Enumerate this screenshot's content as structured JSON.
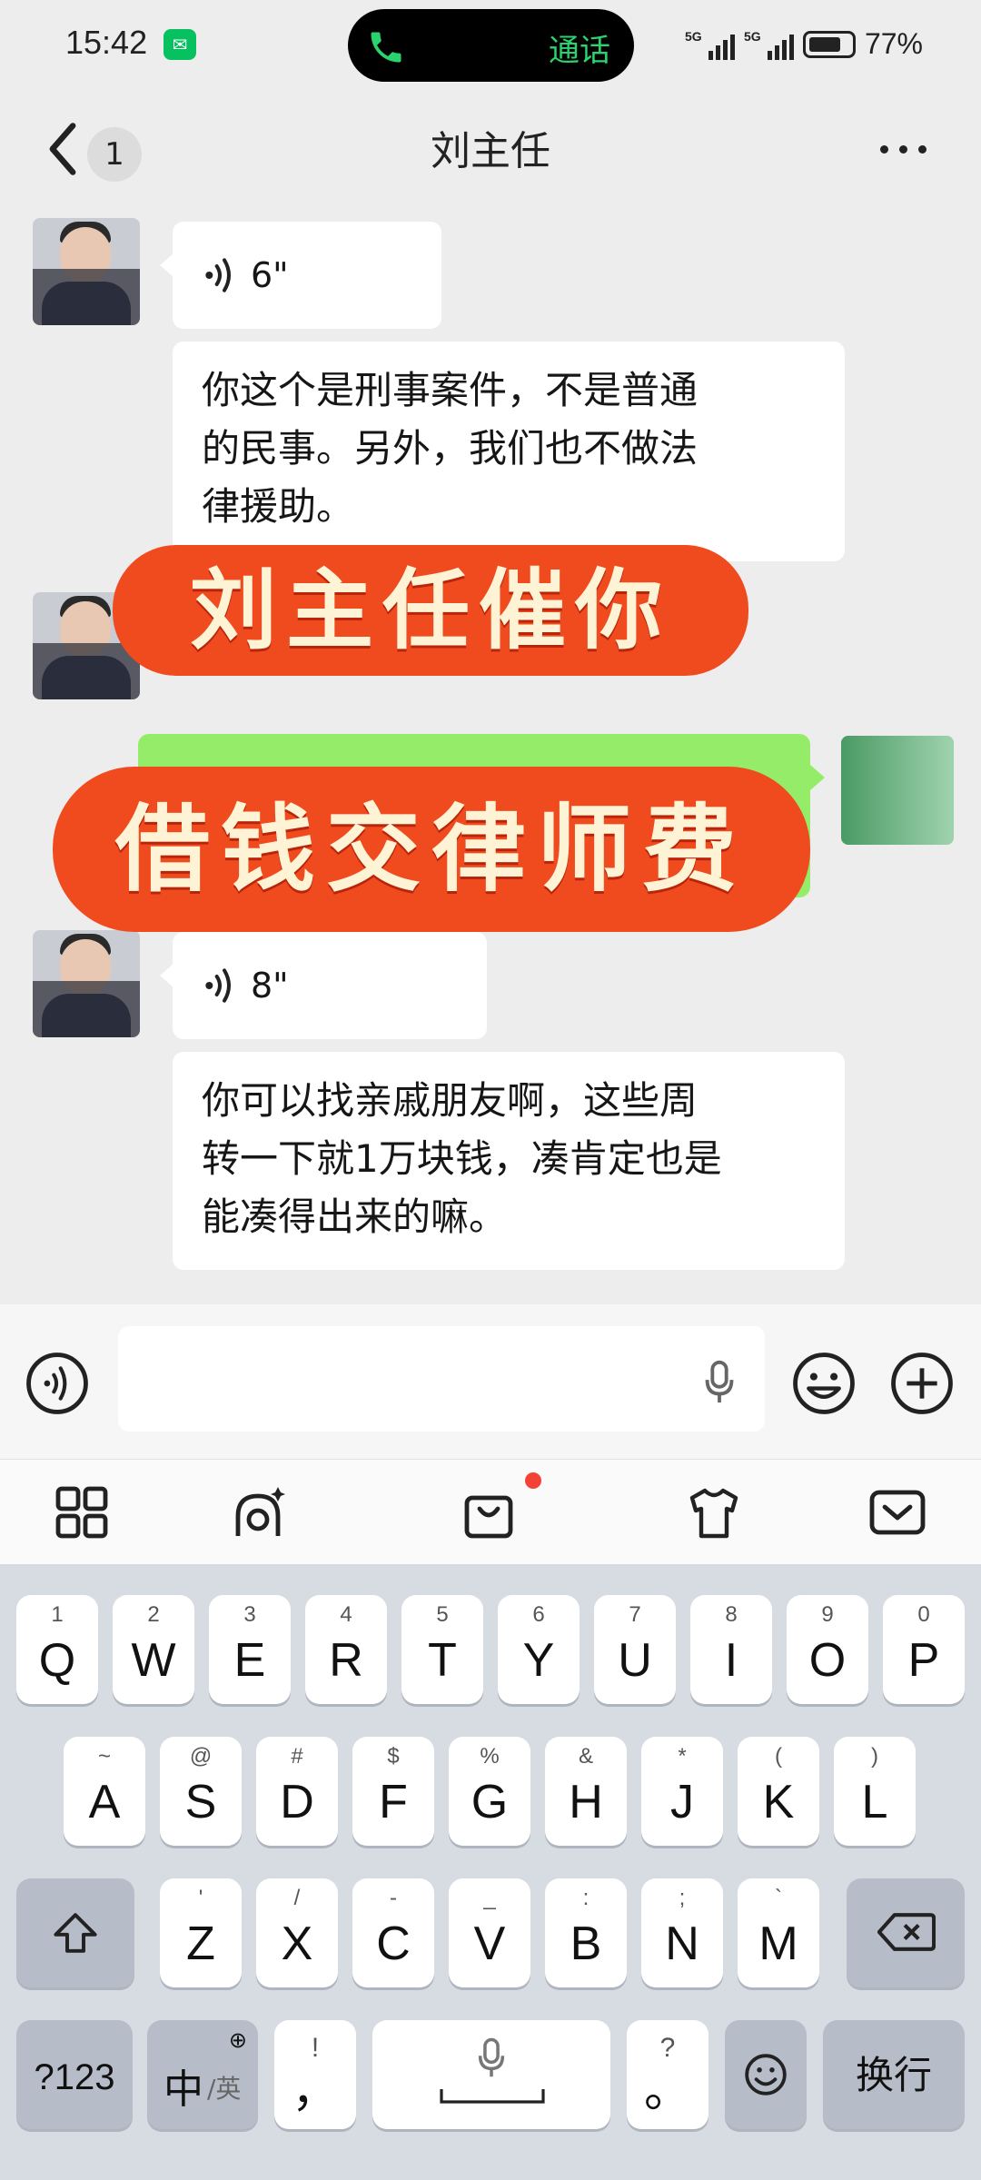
{
  "status_bar": {
    "time": "15:42",
    "call_label": "通话",
    "net1": "5G",
    "net2": "5G",
    "battery": "77%"
  },
  "header": {
    "unread_count": "1",
    "title": "刘主任"
  },
  "messages": [
    {
      "type": "voice",
      "duration": "6\""
    },
    {
      "type": "text",
      "lines": [
        "你这个是刑事案件，不是普通",
        "的民事。另外，我们也不做法",
        "律援助。"
      ]
    },
    {
      "type": "voice",
      "duration": "8\""
    },
    {
      "type": "text",
      "lines": [
        "你可以找亲戚朋友啊，这些周",
        "转一下就1万块钱，凑肯定也是",
        "能凑得出来的嘛。"
      ]
    }
  ],
  "overlay": {
    "line1": "刘主任催你",
    "line2": "借钱交律师费"
  },
  "keyboard": {
    "row1": [
      {
        "main": "Q",
        "sub": "1"
      },
      {
        "main": "W",
        "sub": "2"
      },
      {
        "main": "E",
        "sub": "3"
      },
      {
        "main": "R",
        "sub": "4"
      },
      {
        "main": "T",
        "sub": "5"
      },
      {
        "main": "Y",
        "sub": "6"
      },
      {
        "main": "U",
        "sub": "7"
      },
      {
        "main": "I",
        "sub": "8"
      },
      {
        "main": "O",
        "sub": "9"
      },
      {
        "main": "P",
        "sub": "0"
      }
    ],
    "row2": [
      {
        "main": "A",
        "sub": "~"
      },
      {
        "main": "S",
        "sub": "@"
      },
      {
        "main": "D",
        "sub": "#"
      },
      {
        "main": "F",
        "sub": "$"
      },
      {
        "main": "G",
        "sub": "%"
      },
      {
        "main": "H",
        "sub": "&"
      },
      {
        "main": "J",
        "sub": "*"
      },
      {
        "main": "K",
        "sub": "("
      },
      {
        "main": "L",
        "sub": ")"
      }
    ],
    "row3": [
      {
        "main": "Z",
        "sub": "'"
      },
      {
        "main": "X",
        "sub": "/"
      },
      {
        "main": "C",
        "sub": "-"
      },
      {
        "main": "V",
        "sub": "_"
      },
      {
        "main": "B",
        "sub": ":"
      },
      {
        "main": "N",
        "sub": ";"
      },
      {
        "main": "M",
        "sub": "`"
      }
    ],
    "num_key": "?123",
    "lang_main": "中",
    "lang_sub": "/英",
    "comma_main": "，",
    "comma_sub": "!",
    "period_main": "。",
    "period_sub": "?",
    "enter_key": "换行"
  },
  "colors": {
    "bubble_self": "#95ec69",
    "banner": "#f04a1f",
    "call_green": "#2bd36e"
  }
}
